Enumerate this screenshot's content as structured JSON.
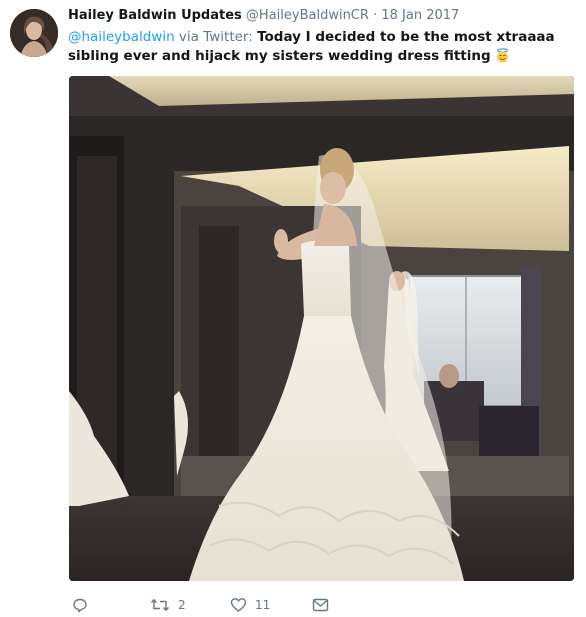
{
  "tweet": {
    "display_name": "Hailey Baldwin Updates",
    "handle": "@HaileyBaldwinCR",
    "separator": "·",
    "date": "18 Jan 2017",
    "mention": "@haileybaldwin",
    "via_text": " via Twitter: ",
    "text": "Today I decided to be the most xtraaaa sibling ever and hijack my sisters wedding dress fitting",
    "emoji": "smiling-face-with-halo"
  },
  "actions": {
    "reply_count": "",
    "retweet_count": "2",
    "like_count": "11"
  },
  "colors": {
    "link": "#1da1f2",
    "muted": "#657786",
    "text": "#14171a"
  }
}
